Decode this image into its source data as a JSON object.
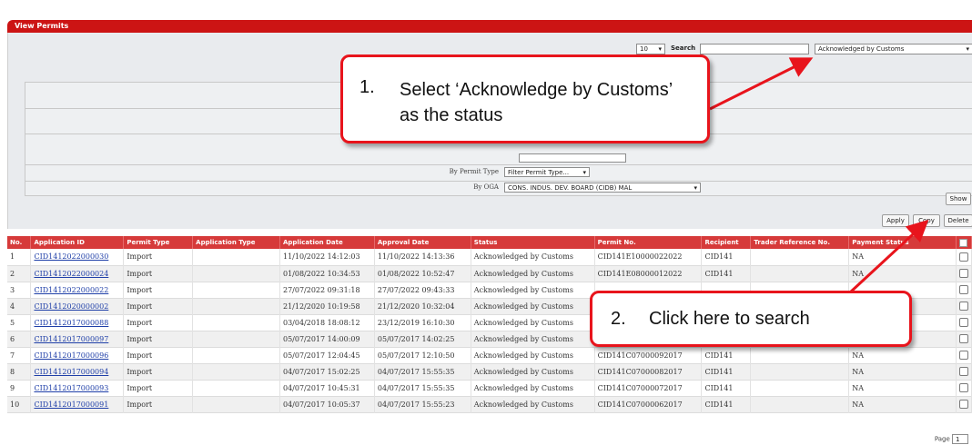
{
  "window": {
    "title": "View Permits"
  },
  "controls": {
    "page_size": "10",
    "search_label": "Search",
    "search_value": "",
    "status_filter": "Acknowledged by Customs"
  },
  "filters": {
    "permit_type_label": "By Permit Type",
    "permit_type_value": "Filter Permit Type...",
    "oga_label": "By OGA",
    "oga_value": "CONS. INDUS. DEV. BOARD (CIDB) MAL"
  },
  "buttons": {
    "show": "Show",
    "apply": "Apply",
    "copy": "Copy",
    "delete": "Delete"
  },
  "table": {
    "columns": [
      "No.",
      "Application ID",
      "Permit Type",
      "Application Type",
      "Application Date",
      "Approval Date",
      "Status",
      "Permit No.",
      "Recipient",
      "Trader Reference No.",
      "Payment Status"
    ],
    "rows": [
      [
        "1",
        "CID1412022000030",
        "Import",
        "",
        "11/10/2022 14:12:03",
        "11/10/2022 14:13:36",
        "Acknowledged by Customs",
        "CID141E10000022022",
        "CID141",
        "",
        "NA"
      ],
      [
        "2",
        "CID1412022000024",
        "Import",
        "",
        "01/08/2022 10:34:53",
        "01/08/2022 10:52:47",
        "Acknowledged by Customs",
        "CID141E08000012022",
        "CID141",
        "",
        "NA"
      ],
      [
        "3",
        "CID1412022000022",
        "Import",
        "",
        "27/07/2022 09:31:18",
        "27/07/2022 09:43:33",
        "Acknowledged by Customs",
        "",
        "",
        "",
        ""
      ],
      [
        "4",
        "CID1412020000002",
        "Import",
        "",
        "21/12/2020 10:19:58",
        "21/12/2020 10:32:04",
        "Acknowledged by Customs",
        "",
        "",
        "",
        ""
      ],
      [
        "5",
        "CID1412017000088",
        "Import",
        "",
        "03/04/2018 18:08:12",
        "23/12/2019 16:10:30",
        "Acknowledged by Customs",
        "",
        "",
        "",
        ""
      ],
      [
        "6",
        "CID1412017000097",
        "Import",
        "",
        "05/07/2017 14:00:09",
        "05/07/2017 14:02:25",
        "Acknowledged by Customs",
        "",
        "",
        "",
        ""
      ],
      [
        "7",
        "CID1412017000096",
        "Import",
        "",
        "05/07/2017 12:04:45",
        "05/07/2017 12:10:50",
        "Acknowledged by Customs",
        "CID141C07000092017",
        "CID141",
        "",
        "NA"
      ],
      [
        "8",
        "CID1412017000094",
        "Import",
        "",
        "04/07/2017 15:02:25",
        "04/07/2017 15:55:35",
        "Acknowledged by Customs",
        "CID141C07000082017",
        "CID141",
        "",
        "NA"
      ],
      [
        "9",
        "CID1412017000093",
        "Import",
        "",
        "04/07/2017 10:45:31",
        "04/07/2017 15:55:35",
        "Acknowledged by Customs",
        "CID141C07000072017",
        "CID141",
        "",
        "NA"
      ],
      [
        "10",
        "CID1412017000091",
        "Import",
        "",
        "04/07/2017 10:05:37",
        "04/07/2017 15:55:23",
        "Acknowledged by Customs",
        "CID141C07000062017",
        "CID141",
        "",
        "NA"
      ]
    ]
  },
  "pager": {
    "label": "Page",
    "value": "1"
  },
  "callouts": {
    "one_number": "1.",
    "one_text": "Select ‘Acknowledge by Customs’ as the status",
    "two_number": "2.",
    "two_text": "Click here to search"
  },
  "colors": {
    "brand_red": "#cc1414",
    "header_red": "#d63a3a",
    "callout_border": "#e8141c",
    "link": "#1f3fa8"
  }
}
